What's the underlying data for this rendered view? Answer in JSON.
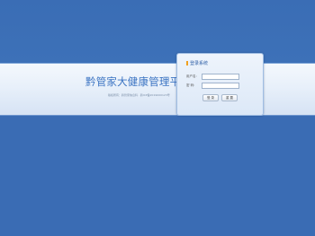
{
  "page": {
    "title": "黔管家大健康管理平台",
    "subtitle": "版权所有：黔管家信息科 · 黔ICP备2019000123号"
  },
  "login": {
    "header": "登录系统",
    "username_label": "用户名:",
    "username_value": "",
    "password_label": "密 码:",
    "password_value": "",
    "login_button": "登 录",
    "reset_button": "重 置"
  },
  "colors": {
    "background": "#3b6eb5",
    "banner": "#e8f0fa",
    "title": "#3a73c2",
    "accent": "#f0a020"
  }
}
